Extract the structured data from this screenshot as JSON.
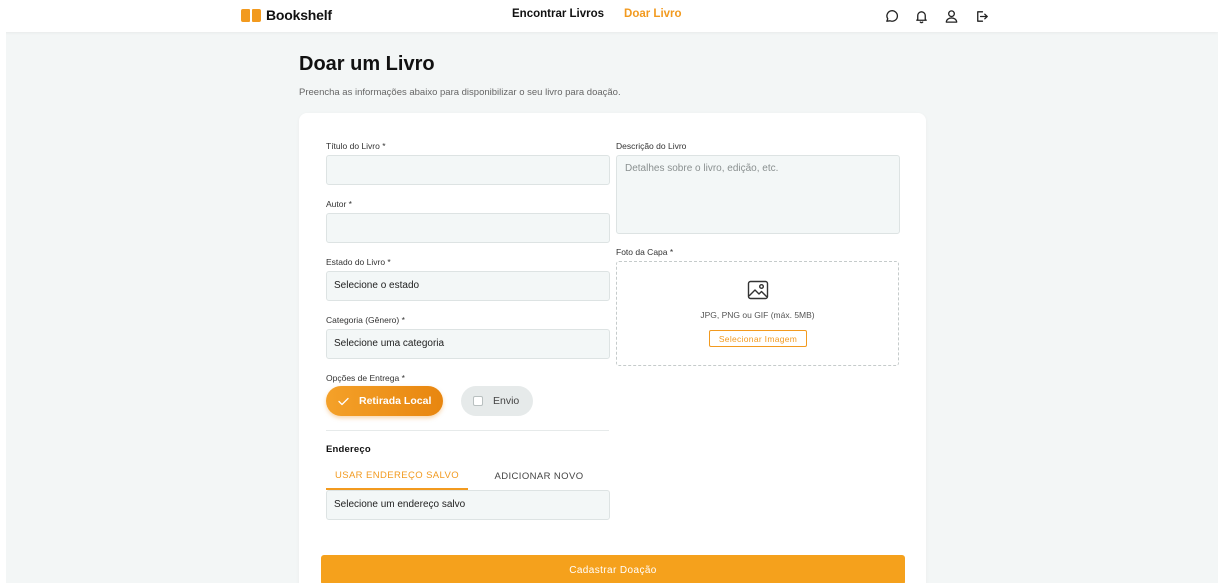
{
  "app": {
    "name": "Bookshelf"
  },
  "nav": {
    "find_books": "Encontrar Livros",
    "donate_book": "Doar Livro"
  },
  "header_icons": [
    "chat-icon",
    "bell-icon",
    "user-icon",
    "logout-icon"
  ],
  "page": {
    "title": "Doar um Livro",
    "subtitle": "Preencha as informações abaixo para disponibilizar o seu livro para doação."
  },
  "form": {
    "title_label": "Título do Livro *",
    "title_value": "",
    "author_label": "Autor *",
    "author_value": "",
    "condition_label": "Estado do Livro *",
    "condition_value": "Selecione o estado",
    "category_label": "Categoria (Gênero) *",
    "category_value": "Selecione uma categoria",
    "delivery_label": "Opções de Entrega *",
    "delivery_options": [
      {
        "label": "Retirada Local",
        "selected": true
      },
      {
        "label": "Envio",
        "selected": false
      }
    ],
    "description_label": "Descrição do Livro",
    "description_placeholder": "Detalhes sobre o livro, edição, etc.",
    "cover_label": "Foto da Capa *",
    "cover_hint": "JPG, PNG ou GIF (máx. 5MB)",
    "cover_button": "Selecionar Imagem",
    "address_title": "Endereço",
    "address_tabs": [
      {
        "label": "USAR ENDEREÇO SALVO",
        "active": true
      },
      {
        "label": "ADICIONAR NOVO",
        "active": false
      }
    ],
    "address_value": "Selecione um endereço salvo",
    "submit_label": "Cadastrar Doação"
  },
  "colors": {
    "accent": "#f29a1f",
    "input_bg": "#f3f7f7",
    "page_bg": "#f3f6f6"
  }
}
